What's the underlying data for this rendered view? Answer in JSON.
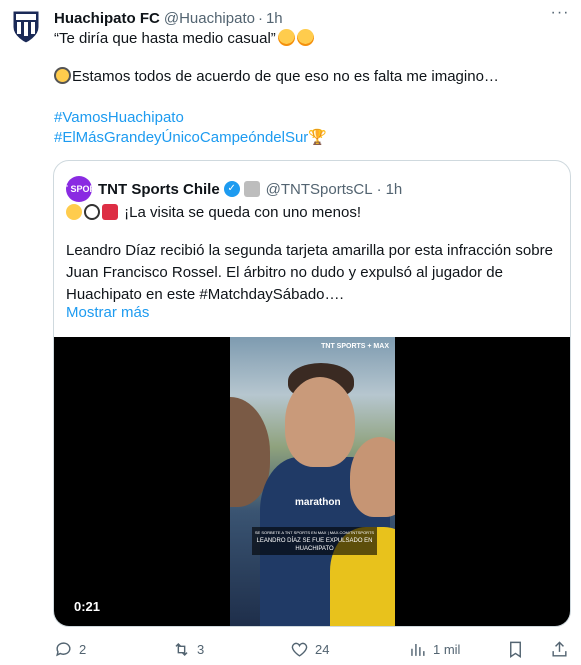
{
  "tweet": {
    "author_name": "Huachipato FC",
    "author_handle": "@Huachipato",
    "separator": "·",
    "time": "1h",
    "line1": "“Te diría que hasta medio casual”",
    "line2": "Estamos todos de acuerdo de que eso no es falta me imagino…",
    "hashtag1": "#VamosHuachipato",
    "hashtag2": "#ElMásGrandeyÚnicoCampeóndelSur",
    "trophy_icon": "🏆"
  },
  "quote": {
    "avatar_text": "TNT SPORTS",
    "author_name": "TNT Sports Chile",
    "author_handle": "@TNTSportsCL",
    "separator": "·",
    "time": "1h",
    "headline": "¡La visita se queda con uno menos!",
    "line1": "Leandro Díaz recibió la segunda tarjeta amarilla por esta infracción sobre",
    "line2": "Juan Francisco Rossel. El árbitro no dudo y expulsó al jugador de",
    "line3": "Huachipato en este #MatchdaySábado….",
    "show_more": "Mostrar más",
    "video": {
      "timestamp": "0:21",
      "brand": "TNT SPORTS + MAX",
      "sponsor": "marathon",
      "caption_small": "SE SORBETE A TNT SPORTS EN MAX | MAX.COM/TNTSPORTS",
      "caption": "LEANDRO DÍAZ SE FUE EXPULSADO EN HUACHIPATO"
    }
  },
  "actions": {
    "replies": "2",
    "retweets": "3",
    "likes": "24",
    "views": "1 mil"
  },
  "colors": {
    "link": "#1d9bf0",
    "secondary": "#536471",
    "border": "#cfd9de",
    "tnt_purple": "#8a2be2"
  }
}
